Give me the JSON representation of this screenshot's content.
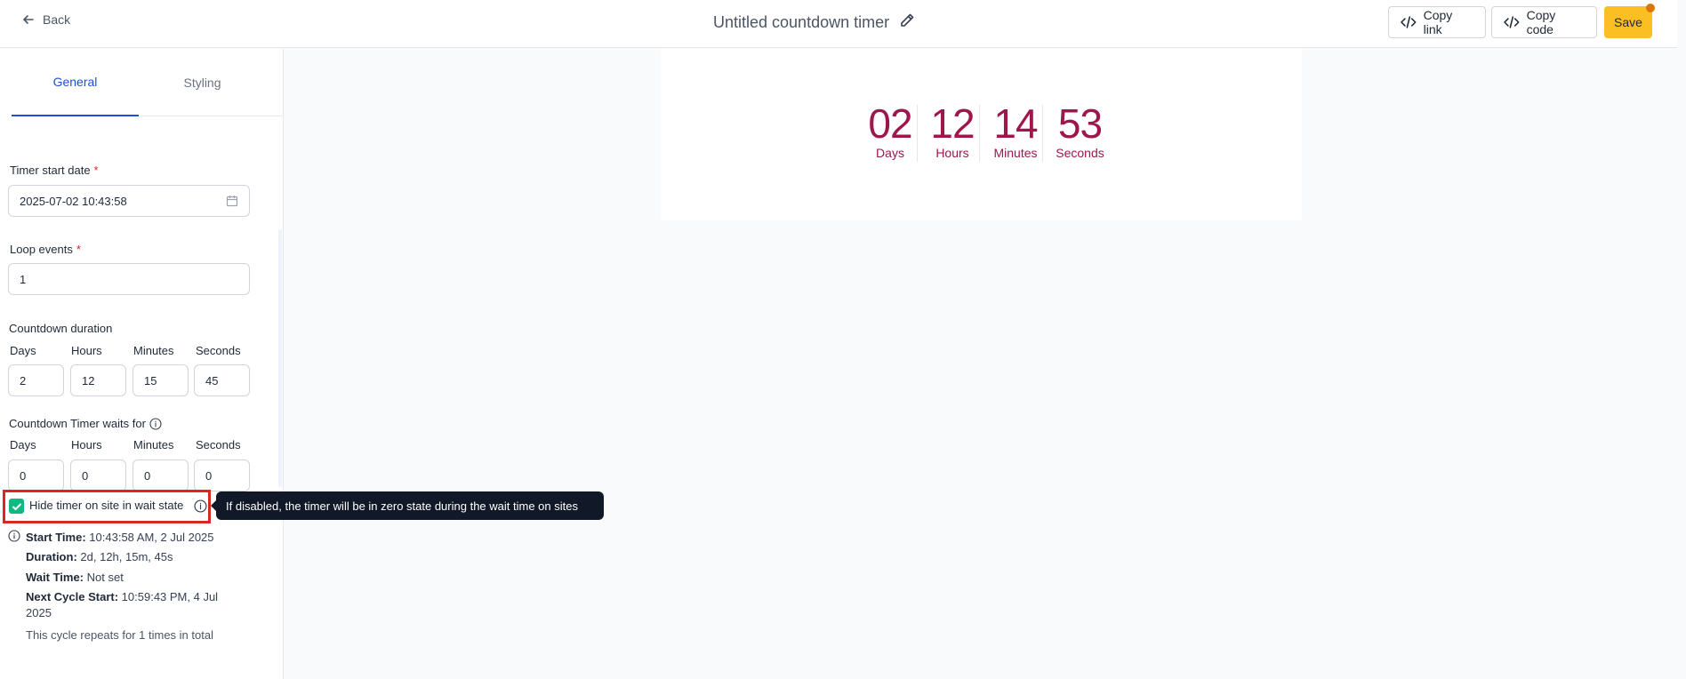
{
  "header": {
    "back_label": "Back",
    "title": "Untitled countdown timer",
    "copy_link_label": "Copy link",
    "copy_code_label": "Copy code",
    "save_label": "Save"
  },
  "tabs": [
    {
      "label": "General",
      "active": true
    },
    {
      "label": "Styling",
      "active": false
    }
  ],
  "form": {
    "start_date_label": "Timer start date",
    "start_date_value": "2025-07-02 10:43:58",
    "loop_label": "Loop events",
    "loop_value": "1",
    "duration_label": "Countdown duration",
    "duration": {
      "labels": [
        "Days",
        "Hours",
        "Minutes",
        "Seconds"
      ],
      "values": [
        "2",
        "12",
        "15",
        "45"
      ]
    },
    "wait_label": "Countdown Timer waits for",
    "wait": {
      "labels": [
        "Days",
        "Hours",
        "Minutes",
        "Seconds"
      ],
      "values": [
        "0",
        "0",
        "0",
        "0"
      ]
    },
    "hide_timer_label": "Hide timer on site in wait state",
    "hide_timer_checked": true,
    "required_mark": "*"
  },
  "tooltip": "If disabled, the timer will be in zero state during the wait time on sites",
  "summary": {
    "start_time_key": "Start Time:",
    "start_time_value": "10:43:58 AM, 2 Jul 2025",
    "duration_key": "Duration:",
    "duration_value": "2d, 12h, 15m, 45s",
    "wait_time_key": "Wait Time:",
    "wait_time_value": "Not set",
    "next_cycle_key": "Next Cycle Start:",
    "next_cycle_value_1": "10:59:43 PM, 4 Jul",
    "next_cycle_value_2": "2025",
    "repeat_text": "This cycle repeats for 1 times in total"
  },
  "preview": {
    "units": [
      {
        "value": "02",
        "label": "Days"
      },
      {
        "value": "12",
        "label": "Hours"
      },
      {
        "value": "14",
        "label": "Minutes"
      },
      {
        "value": "53",
        "label": "Seconds"
      }
    ],
    "accent_color": "#9d174d"
  },
  "colors": {
    "save_bg": "#fbbf24",
    "tab_active": "#1d4ed8",
    "checkbox": "#10b981",
    "highlight": "#dc2626"
  }
}
